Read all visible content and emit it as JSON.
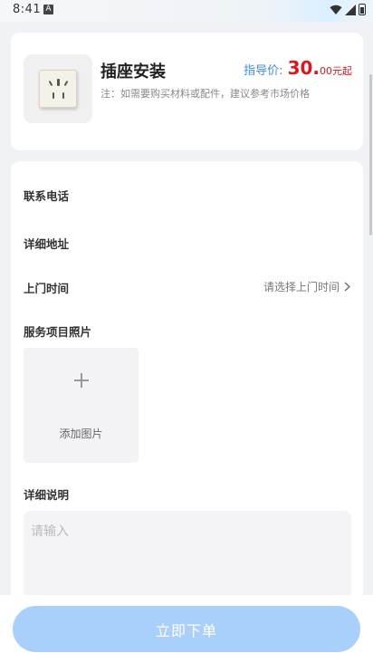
{
  "status_bar": {
    "time": "8:41",
    "notification_badge": "A"
  },
  "product": {
    "title": "插座安装",
    "price_label": "指导价:",
    "price_integer": "30.",
    "price_decimal": "00",
    "price_unit": "元起",
    "note": "注：如需要购买材料或配件，建议参考市场价格"
  },
  "form": {
    "phone_label": "联系电话",
    "address_label": "详细地址",
    "time_label": "上门时间",
    "time_placeholder": "请选择上门时间",
    "photos_label": "服务项目照片",
    "add_photo_label": "添加图片",
    "description_label": "详细说明",
    "description_placeholder": "请输入"
  },
  "actions": {
    "order_label": "立即下单"
  },
  "colors": {
    "accent_blue": "#3c8ef0",
    "price_red": "#e0141c",
    "button_disabled": "#a9d0fb"
  },
  "icons": [
    "wifi-icon",
    "signal-icon",
    "battery-icon",
    "socket-image",
    "chevron-right-icon",
    "plus-icon"
  ]
}
